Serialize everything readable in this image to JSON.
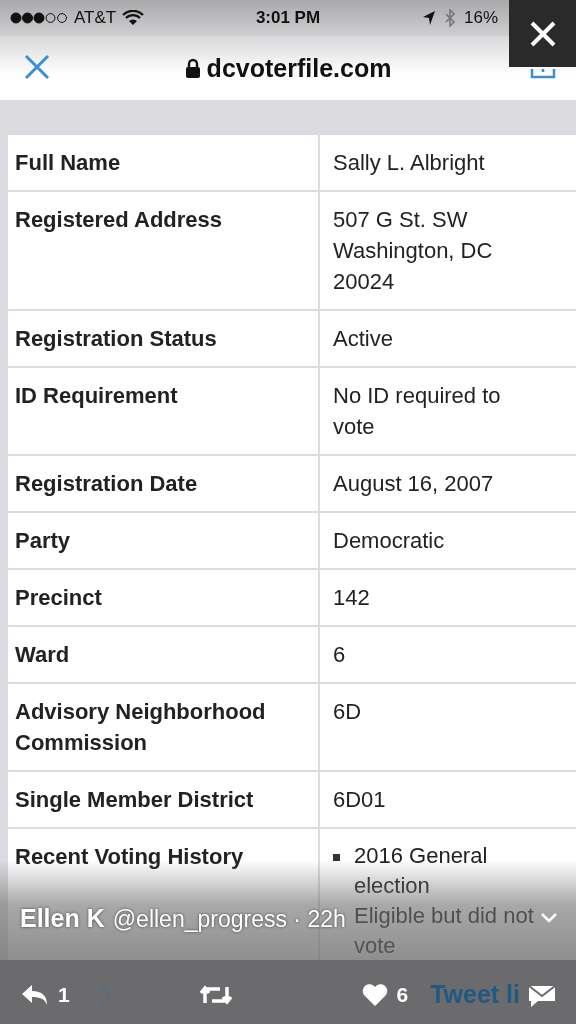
{
  "status_bar": {
    "carrier": "AT&T",
    "time": "3:01 PM",
    "battery": "16%"
  },
  "browser": {
    "url": "dcvoterfile.com"
  },
  "table": {
    "rows": [
      {
        "kind": "text",
        "label": "Full Name",
        "lines": [
          "Sally L. Albright"
        ]
      },
      {
        "kind": "text",
        "label": "Registered Address",
        "lines": [
          "507 G St. SW",
          "Washington, DC",
          "20024"
        ]
      },
      {
        "kind": "text",
        "label": "Registration Status",
        "lines": [
          "Active"
        ]
      },
      {
        "kind": "text",
        "label": "ID Requirement",
        "lines": [
          "No ID required to",
          "vote"
        ]
      },
      {
        "kind": "text",
        "label": "Registration Date",
        "lines": [
          "August 16, 2007"
        ]
      },
      {
        "kind": "text",
        "label": "Party",
        "lines": [
          "Democratic"
        ]
      },
      {
        "kind": "text",
        "label": "Precinct",
        "lines": [
          "142"
        ]
      },
      {
        "kind": "text",
        "label": "Ward",
        "lines": [
          "6"
        ]
      },
      {
        "kind": "text",
        "label": "Advisory Neighborhood Commission",
        "lines": [
          "6D"
        ]
      },
      {
        "kind": "text",
        "label": "Single Member District",
        "lines": [
          "6D01"
        ]
      },
      {
        "kind": "list",
        "label": "Recent Voting History",
        "lines": [
          "2016 General",
          "election"
        ],
        "sub": [
          "Eligible but did not",
          "vote"
        ]
      }
    ]
  },
  "tweet": {
    "author": "Ellen K",
    "handle_time": "@ellen_progress · 22h",
    "replies": "1",
    "likes": "6",
    "link": "Tweet li"
  }
}
